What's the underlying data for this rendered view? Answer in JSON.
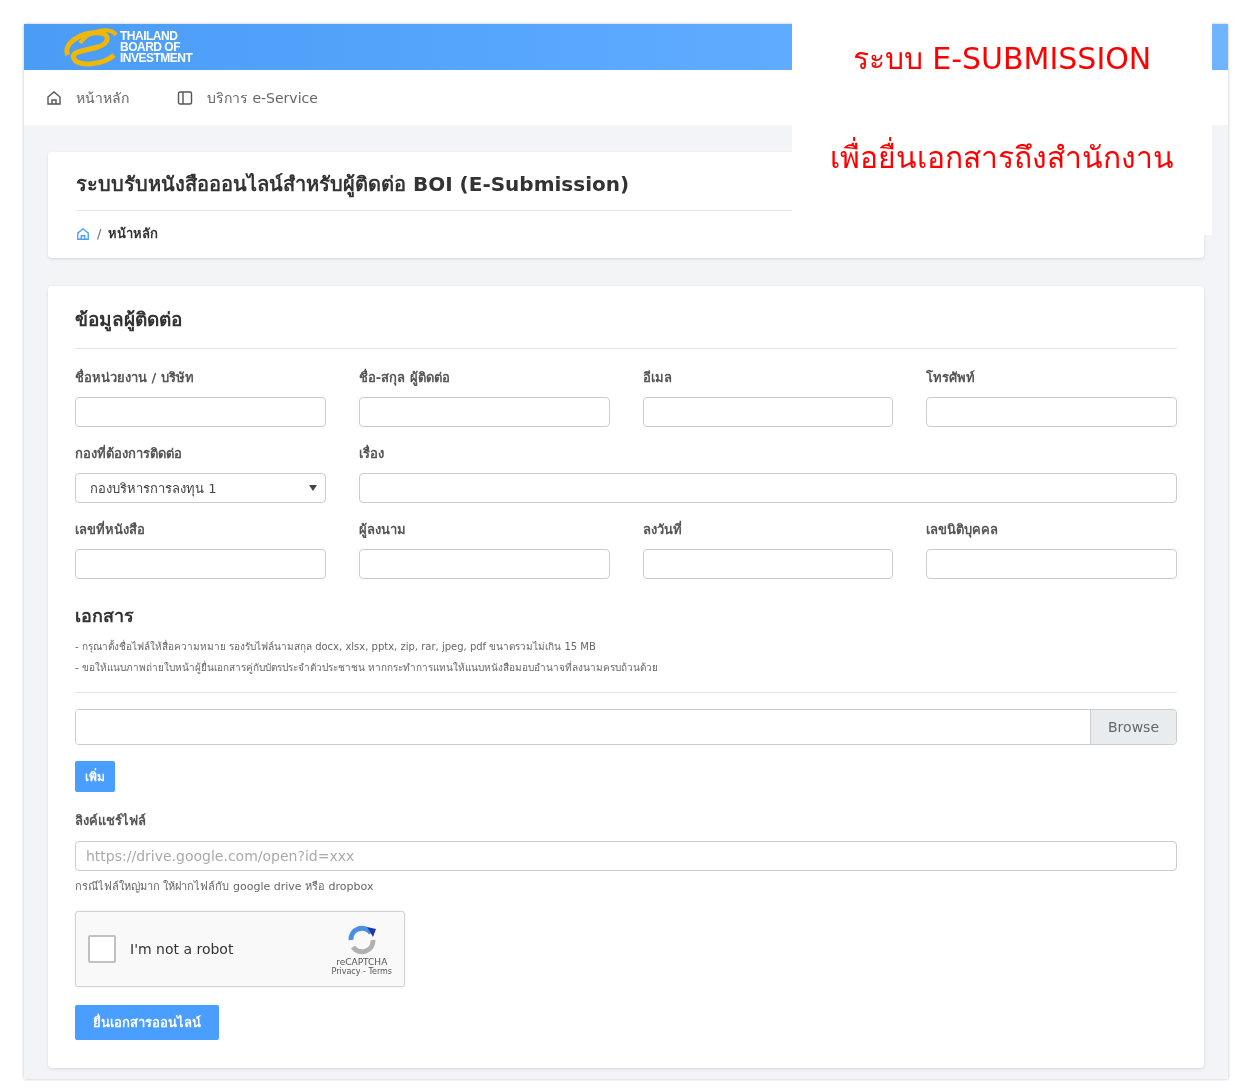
{
  "header": {
    "logo_lines": [
      "THAILAND",
      "BOARD OF",
      "INVESTMENT"
    ]
  },
  "nav": {
    "items": [
      {
        "kind": "home",
        "label": "หน้าหลัก"
      },
      {
        "kind": "panel",
        "label": "บริการ e-Service"
      }
    ]
  },
  "page_header": {
    "title": "ระบบรับหนังสือออนไลน์สำหรับผู้ติดต่อ BOI (E-Submission)",
    "breadcrumb": [
      {
        "kind": "home"
      },
      {
        "kind": "text",
        "separator": "/",
        "label": "หน้าหลัก"
      }
    ]
  },
  "annotation": {
    "lines": [
      "ระบบ E-SUBMISSION",
      "เพื่อยื่นเอกสารถึงสำนักงาน"
    ]
  },
  "contact": {
    "title": "ข้อมูลผู้ติดต่อ",
    "fields": [
      {
        "label": "ชื่อหน่วยงาน / บริษัท",
        "kind": "text"
      },
      {
        "label": "ชื่อ-สกุล ผู้ติดต่อ",
        "kind": "text"
      },
      {
        "label": "อีเมล",
        "kind": "text"
      },
      {
        "label": "โทรศัพท์",
        "kind": "text"
      },
      {
        "label": "กองที่ต้องการติดต่อ",
        "kind": "select",
        "value": "กองบริหารการลงทุน 1"
      },
      {
        "label": "เรื่อง",
        "kind": "wide"
      },
      {
        "label": "เลขที่หนังสือ",
        "kind": "text"
      },
      {
        "label": "ผู้ลงนาม",
        "kind": "text"
      },
      {
        "label": "ลงวันที่",
        "kind": "text"
      },
      {
        "label": "เลขนิติบุคคล",
        "kind": "text"
      }
    ]
  },
  "documents": {
    "title": "เอกสาร",
    "notes": [
      "- กรุณาตั้งชื่อไฟล์ให้สื่อความหมาย รองรับไฟล์นามสกุล docx, xlsx, pptx, zip, rar, jpeg, pdf ขนาดรวมไม่เกิน 15 MB",
      "- ขอให้แนบภาพถ่ายใบหน้าผู้ยื่นเอกสารคู่กับบัตรประจำตัวประชาชน หากกระทำการแทนให้แนบหนังสือมอบอำนาจที่ลงนามครบถ้วนด้วย"
    ],
    "browse_button": "Browse",
    "add_button": "เพิ่ม",
    "share_label": "ลิงค์แชร์ไฟล์",
    "share_placeholder": "https://drive.google.com/open?id=xxx",
    "share_hint": "กรณีไฟล์ใหญ่มาก ให้ฝากไฟล์กับ google drive หรือ dropbox",
    "captcha": {
      "label": "I'm not a robot",
      "checked": false,
      "brand": "reCAPTCHA",
      "links": "Privacy - Terms"
    },
    "submit_button": "ยื่นเอกสารออนไลน์"
  }
}
